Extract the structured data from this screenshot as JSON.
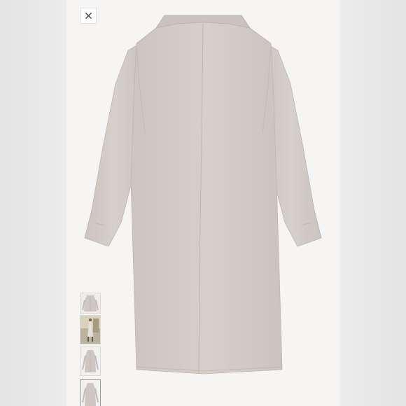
{
  "viewer": {
    "close_icon": "close-icon",
    "thumbnails": [
      {
        "name": "thumbnail-1",
        "icon": "coat-front-photo"
      },
      {
        "name": "thumbnail-2",
        "icon": "model-street-photo"
      },
      {
        "name": "thumbnail-3",
        "icon": "coat-flat-photo"
      },
      {
        "name": "thumbnail-4",
        "icon": "coat-back-photo",
        "selected": true
      }
    ]
  },
  "colors": {
    "coat": "#d3ccc8",
    "coat_shadow": "#c2bab5",
    "panel_bg": "#f6f5f4",
    "page_bg": "#e9e9e9"
  }
}
